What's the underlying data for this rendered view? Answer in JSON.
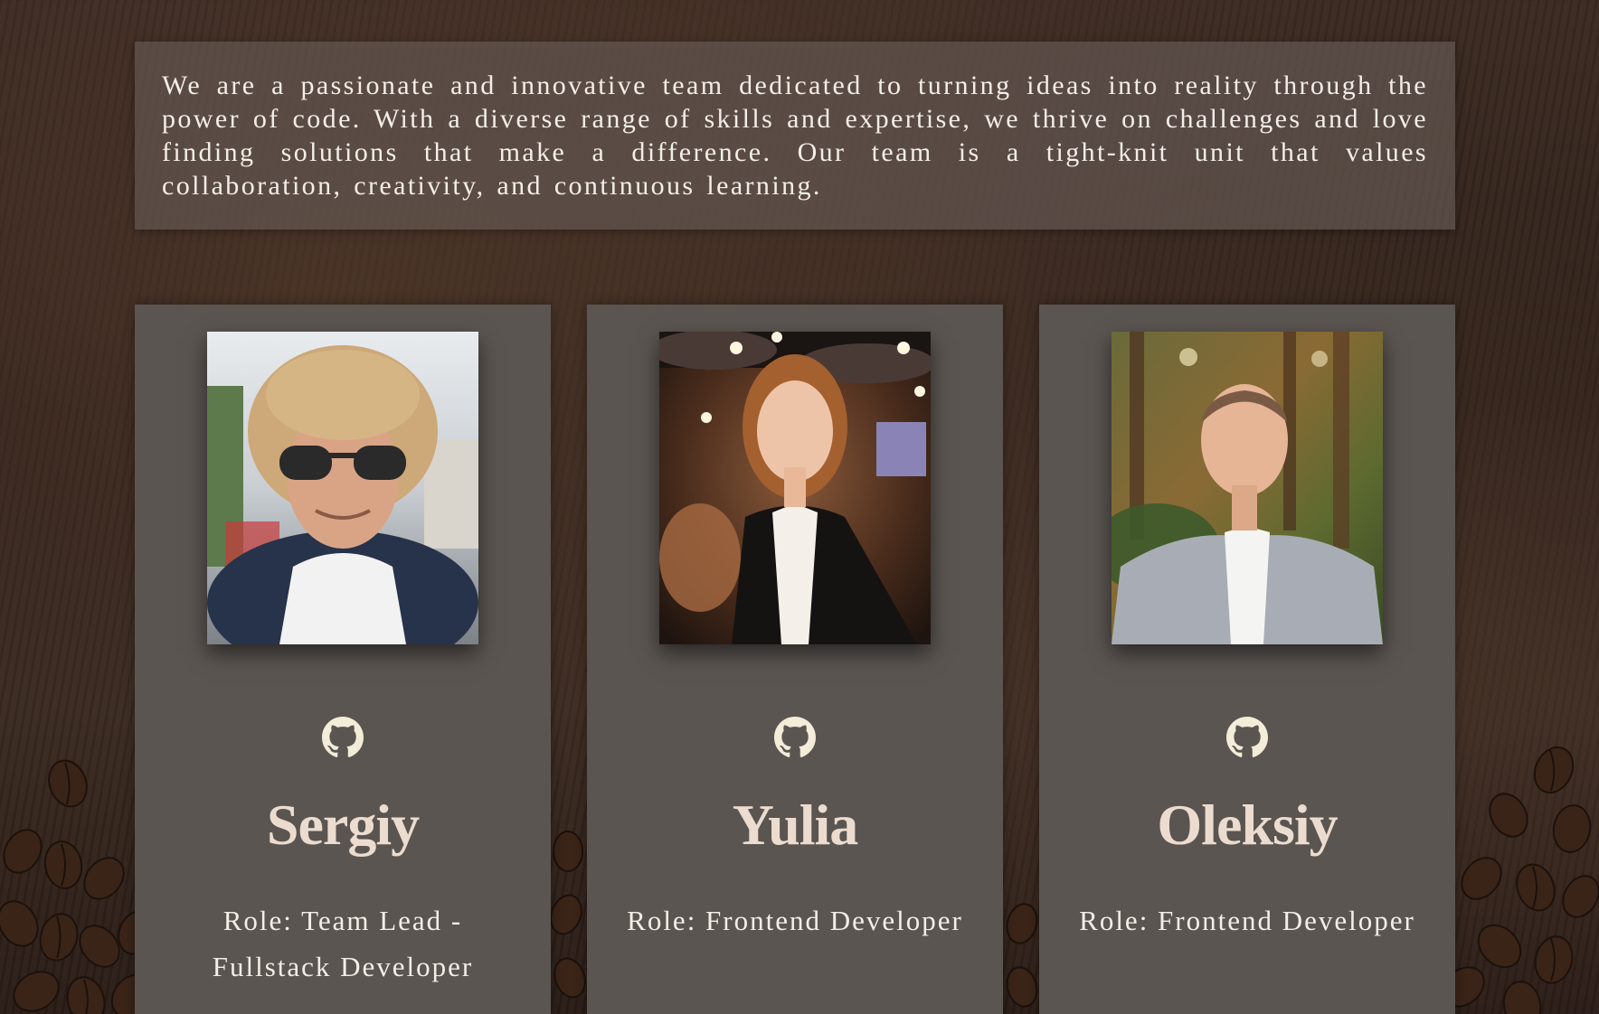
{
  "intro": {
    "text": "We are a passionate and innovative team dedicated to turning ideas into reality through the power of code. With a diverse range of skills and expertise, we thrive on challenges and love finding solutions that make a difference. Our team is a tight-knit unit that values collaboration, creativity, and continuous learning."
  },
  "team": [
    {
      "name": "Sergiy",
      "role": "Role: Team Lead - Fullstack Developer",
      "icon": "github-icon"
    },
    {
      "name": "Yulia",
      "role": "Role: Frontend Developer",
      "icon": "github-icon"
    },
    {
      "name": "Oleksiy",
      "role": "Role: Frontend Developer",
      "icon": "github-icon"
    }
  ],
  "colors": {
    "card_background": "#5b5551",
    "name_text": "#ecdcd0",
    "icon": "#f3ecd9",
    "body_text": "#f4eee8"
  }
}
